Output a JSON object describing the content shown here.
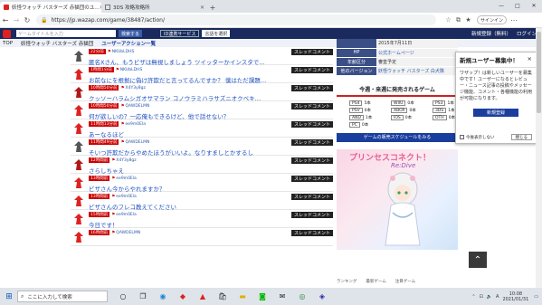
{
  "browser": {
    "tabs": [
      {
        "label": "妖怪ウォッチ バスターズ 赤猫団のユ…",
        "active": true
      },
      {
        "label": "3DS 攻略攻略所",
        "active": false
      }
    ],
    "new_tab": "+",
    "url": "https://jp.wazap.com/game/38487/action/",
    "signin_label": "サインイン",
    "window_controls": [
      "—",
      "□",
      "✕"
    ]
  },
  "site": {
    "search_placeholder": "ゲームタイトルを入力",
    "search_button": "検索する",
    "id_service": "ID連携サービス",
    "lang_select": "言語を選択",
    "register": "新規登録（無料）",
    "login": "ログイン"
  },
  "breadcrumb": [
    "TOP",
    "妖怪ウォッチ バスターズ 赤猫団",
    "ユーザーアクション一覧"
  ],
  "thread_label": "スレッドコメント",
  "rows": [
    {
      "time": "22分前",
      "user": "NKUbLDHS",
      "msg": "匿名Xさん、もうビザは無視しましょう ツイッターかインスタで…",
      "avatar": "gray"
    },
    {
      "time": "1時間1分前",
      "user": "NKUbLDHS",
      "msg": "お前なにを根拠に偽け許欺だと言ってるんですか？ 僕はただ課題…",
      "avatar": "red"
    },
    {
      "time": "10時間50分前",
      "user": "X4Y3y8gz",
      "msg": "クッソーハラムシガオサマラン コノウラミハラサズニオクベキ…",
      "avatar": "red2"
    },
    {
      "time": "10時間50分前",
      "user": "QAWDELMN",
      "msg": "何が欲しいの？一応俺もできるけど、他で話せない？",
      "avatar": "red"
    },
    {
      "time": "11時間13分前",
      "user": "ee9m0Ela",
      "msg": "あーなるほど",
      "avatar": "red"
    },
    {
      "time": "11時間49分前",
      "user": "QAWDELMN",
      "msg": "そいつ許欺だからやめたほうがいいよ。なりすましとかするし",
      "avatar": "gray"
    },
    {
      "time": "12時間前",
      "user": "X4Y3y8gz",
      "msg": "さらしちゃえ",
      "avatar": "red2"
    },
    {
      "time": "13時間前",
      "user": "ee9m0Ela",
      "msg": "ビザさん今からやれますか？",
      "avatar": "red"
    },
    {
      "time": "13時間前",
      "user": "ee9m0Ela",
      "msg": "ビザさんのフレコ教えてください",
      "avatar": "red"
    },
    {
      "time": "15時間前",
      "user": "ee9m0Ela",
      "msg": "今日です！",
      "avatar": "red"
    },
    {
      "time": "16時間前",
      "user": "QAWDELMN",
      "msg": "",
      "avatar": "red"
    }
  ],
  "info": [
    {
      "k": "",
      "v": "2015年7月11日"
    },
    {
      "k": "HP",
      "v": "公式ホームページ"
    },
    {
      "k": "年齢区分",
      "v": "審査予定"
    },
    {
      "k": "他のバージョン",
      "v": "妖怪ウォッチ バスターズ 白犬隊"
    }
  ],
  "upcoming": {
    "title": "今週・来週に発売されるゲーム",
    "counts": [
      {
        "p": "PS4",
        "n": "5本"
      },
      {
        "p": "WIIU",
        "n": "0本"
      },
      {
        "p": "PS3",
        "n": "1本"
      },
      {
        "p": "PSV",
        "n": "0本"
      },
      {
        "p": "XBOX",
        "n": "0本"
      },
      {
        "p": "3DS",
        "n": "1本"
      },
      {
        "p": "AND",
        "n": "1本"
      },
      {
        "p": "IOS",
        "n": "0本"
      },
      {
        "p": "OTH",
        "n": "0本"
      },
      {
        "p": "PC",
        "n": "0本"
      }
    ],
    "schedule_button": "ゲームの販売スケジュールをみる"
  },
  "ad": {
    "title": "プリンセスコネクト！",
    "subtitle": "Re:Dive"
  },
  "footer_tabs": [
    "ランキング",
    "最新ゲーム",
    "注目ゲーム"
  ],
  "popup": {
    "title": "新規ユーザー募集中！",
    "close": "×",
    "body": "ワザップ！は新しいユーザーを募集中です！ユーザーになるとレビュー・ニュース記事の投稿やメッセージ機能、コメント・各種機能の利用が可能になります。",
    "register": "新規登録",
    "dont_show": "今後表示しない",
    "close_button": "閉じる"
  },
  "taskbar": {
    "search_placeholder": "ここに入力して検索",
    "time": "10:08",
    "date": "2021/01/31",
    "lang": "A"
  },
  "colors": {
    "brand": "#1a2a5e",
    "accent": "#c00",
    "link": "#1d52c4"
  }
}
